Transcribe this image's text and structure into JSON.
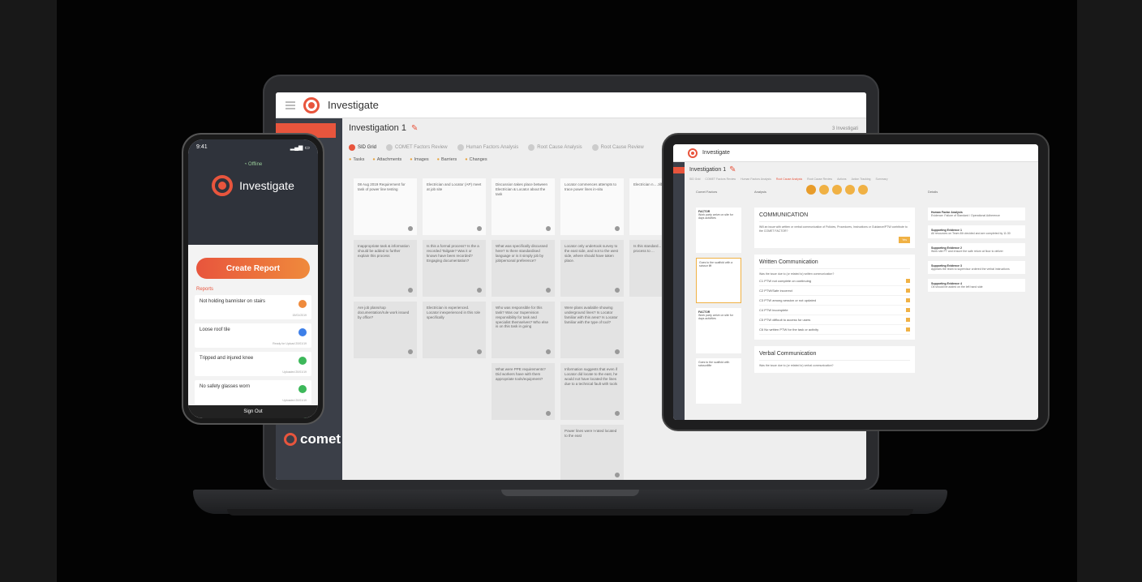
{
  "laptop": {
    "app_title": "Investigate",
    "investigation_title": "Investigation 1",
    "search_label": "3 Investigati",
    "tabs": [
      {
        "label": "SID Grid"
      },
      {
        "label": "COMET Factors Review"
      },
      {
        "label": "Human Factors Analysis"
      },
      {
        "label": "Root Cause Analysis"
      },
      {
        "label": "Root Cause Review"
      }
    ],
    "chips": [
      "Tasks",
      "Attachments",
      "Images",
      "Barriers",
      "Changes"
    ],
    "grid_columns": [
      [
        "08 Aug 2019 Requirement for task of power line testing",
        "Inappropriate task & information should be added to further explain this process",
        "Are job plans/sop documentation/rule work issued by office?"
      ],
      [
        "Electrician and Locator (AP) meet at job site",
        "Is this a formal process? Is the a recorded Tailgate? Was it or known have been recorded? Engaging documentation?",
        "Electrician is experienced. Locator inexperienced in this role specifically"
      ],
      [
        "Discussion takes place between Electrician & Locator about the task",
        "What was specifically discussed here? Is there standardised language or is it simply job by job/personal preference?",
        "Who was responsible for this task? Was our Supervision responsibility for task and specialist themselves? Who else is on this task in going",
        "What were PPE requirements? Did workers have with them appropriate tools/equipment?"
      ],
      [
        "Locator commences attempts to trace power lines in-situ",
        "Locator only undertook survey to the east side, and not to the west side, where should have taken place.",
        "Were plans available showing underground lines? Is Locator familiar with this area? Is Locator familiar with the type of tool?",
        "Information suggests that even if Locator did locate to the east, he would not have located the lines due to a technical fault with tools",
        "Power lines were t-rated located to the east"
      ],
      [
        "Electrician n... Jilba wide o...",
        "Is this standard... What was the ... process to ..."
      ]
    ],
    "brand": "comet"
  },
  "phone": {
    "time": "9:41",
    "offline": "Offline",
    "app_title": "Investigate",
    "create_label": "Create Report",
    "reports_label": "Reports",
    "reports": [
      {
        "title": "Not holding bannister on stairs",
        "date": "15/01/2019",
        "color": "#ef8a3c"
      },
      {
        "title": "Loose roof tile",
        "date": "Ready for Upload 20/01/19",
        "color": "#3d7fe8"
      },
      {
        "title": "Tripped and injured knee",
        "date": "Uploaded 20/01/19",
        "color": "#3db85a"
      },
      {
        "title": "No safety glasses worn",
        "date": "Uploaded 20/01/19",
        "color": "#3db85a"
      },
      {
        "title": "Not holding bannister on stairs",
        "date": "Uploaded 20/01/19",
        "color": "#3db85a"
      }
    ],
    "sign_out": "Sign Out"
  },
  "tablet": {
    "app_title": "Investigate",
    "investigation_title": "Investigation 1",
    "steps": [
      "SID Grid",
      "COMET Factors Review",
      "Human Factors Analysis",
      "Root Cause Analysis",
      "Root Cause Review",
      "Actions",
      "Action Tracking",
      "Summary"
    ],
    "col_factors": "Comet Factors",
    "col_analysis": "Analysis",
    "col_details": "Details",
    "factors": [
      {
        "title": "FACTOR",
        "text": "Work party arrive on site for days activities"
      },
      {
        "title": "",
        "text": "Goes to the scaffold with a scissor lift"
      },
      {
        "title": "FACTOR",
        "text": "Work party arrive on site for days activities"
      },
      {
        "title": "",
        "text": "Goes to the scaffold with scissorlifte"
      }
    ],
    "panel1": {
      "title": "COMMUNICATION",
      "text": "Will an issue with written or verbal communication of Policies, Procedures, Instructions or Guidance/PTW contribute to the COMET FACTOR?",
      "yes": "Yes"
    },
    "panel2": {
      "title": "Written Communication",
      "text": "Was the issue due to (or related to) written communication?",
      "items": [
        "C1  PTW not complete on continuing",
        "C2  PTW/Safe incorrect",
        "C3  PTW among session or not updated",
        "C4  PTW incomplete",
        "C5  PTW difficult to access for users",
        "C6  No written PTW for the task or activity"
      ]
    },
    "panel3": {
      "title": "Verbal Communication",
      "text": "Was the issue due to (or related to) verbal communication?"
    },
    "details": [
      {
        "title": "Human Factor Analysis",
        "text": "Evidence: Failure of Standard / Operational Adherence"
      },
      {
        "title": "Supporting Evidence 1",
        "text": "All resources on Team 4th decided and are completed by 11:30"
      },
      {
        "title": "Supporting Evidence 2",
        "text": "Work site PT and ensure the safe return at floor to deliver"
      },
      {
        "title": "Supporting Evidence 3",
        "text": "Appears the team to supervisor ordered the verbal instructions"
      },
      {
        "title": "Supporting Evidence 4",
        "text": "Oil should be added on the left hand side"
      }
    ]
  }
}
